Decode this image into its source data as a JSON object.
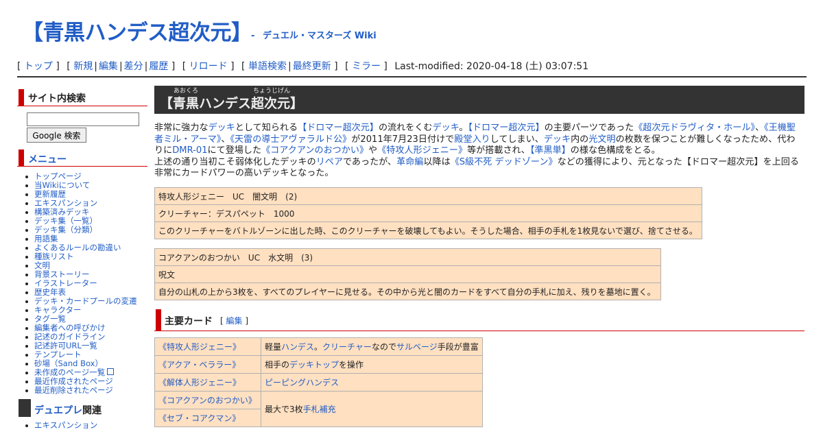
{
  "header": {
    "title": "【青黒ハンデス超次元】",
    "subtitle_dash": "-",
    "subtitle": "デュエル・マスターズ Wiki"
  },
  "nav": {
    "top": "トップ",
    "new": "新規",
    "edit": "編集",
    "diff": "差分",
    "history": "履歴",
    "reload": "リロード",
    "word_search": "単語検索",
    "recent": "最終更新",
    "mirror": "ミラー",
    "last_modified": "Last-modified: 2020-04-18 (土) 03:07:51"
  },
  "sidebar": {
    "search_heading": "サイト内検索",
    "search_value": "",
    "search_button": "Google 検索",
    "menu_heading": "メニュー",
    "menu_items": [
      "トップページ",
      "当Wikiについて",
      "更新履歴",
      "エキスパンション",
      "構築済みデッキ",
      "デッキ集（一覧）",
      "デッキ集（分類）",
      "用語集",
      "よくあるルールの勘違い",
      "種族リスト",
      "文明",
      "背景ストーリー",
      "イラストレーター",
      "歴史年表",
      "デッキ・カードプールの変遷",
      "キャラクター",
      "タグ一覧",
      "編集者への呼びかけ",
      "記述のガイドライン",
      "記述許可URL一覧",
      "テンプレート",
      "砂場（Sand Box）",
      "未作成のページ一覧",
      "最近作成されたページ",
      "最近削除されたページ"
    ],
    "dp_heading_link": "デュエプレ",
    "dp_heading_rest": "関連",
    "dp_items": [
      "エキスパンション"
    ]
  },
  "article": {
    "title": "【青黒ハンデス超次元】",
    "ruby_1": "あおくろ",
    "ruby_2": "ちょうじげん",
    "intro": [
      {
        "t": "非常に強力な"
      },
      {
        "t": "デッキ",
        "l": 1
      },
      {
        "t": "として知られる"
      },
      {
        "t": "【ドロマー超次元】",
        "l": 1
      },
      {
        "t": "の流れをくむ"
      },
      {
        "t": "デッキ",
        "l": 1
      },
      {
        "t": "。"
      },
      {
        "t": "【ドロマー超次元】",
        "l": 1
      },
      {
        "t": "の主要パーツであった"
      },
      {
        "t": "《超次元ドラヴィタ・ホール》",
        "l": 1
      },
      {
        "t": "、"
      },
      {
        "t": "《王機聖者ミル・アーマ》",
        "l": 1
      },
      {
        "t": "、"
      },
      {
        "t": "《天雷の導士アヴァラルド公》",
        "l": 1
      },
      {
        "t": "が2011年7月23日付けで"
      },
      {
        "t": "殿堂入り",
        "l": 1
      },
      {
        "t": "してしまい、"
      },
      {
        "t": "デッキ",
        "l": 1
      },
      {
        "t": "内の"
      },
      {
        "t": "光文明",
        "l": 1
      },
      {
        "t": "の枚数を保つことが難しくなったため、代わりに"
      },
      {
        "t": "DMR-01",
        "l": 1
      },
      {
        "t": "にて登場した"
      },
      {
        "t": "《コアクアンのおつかい》",
        "l": 1
      },
      {
        "t": "や"
      },
      {
        "t": "《特攻人形ジェニー》",
        "l": 1
      },
      {
        "t": "等が搭載され、"
      },
      {
        "t": "【準黒単】",
        "l": 1
      },
      {
        "t": "の様な色構成をとる。"
      },
      {
        "br": 1
      },
      {
        "t": "上述の通り当初こそ弱体化したデッキの"
      },
      {
        "t": "リペア",
        "l": 1
      },
      {
        "t": "であったが、"
      },
      {
        "t": "革命編",
        "l": 1
      },
      {
        "t": "以降は"
      },
      {
        "t": "《S級不死 デッドゾーン》",
        "l": 1
      },
      {
        "t": "などの獲得により、元となった【ドロマー超次元】を上回る非常にカードパワーの高いデッキとなった。"
      }
    ],
    "card1": {
      "line1": "特攻人形ジェニー　UC　闇文明　(2)",
      "line2": "クリーチャー：デスパペット　1000",
      "line3": "このクリーチャーをバトルゾーンに出した時、このクリーチャーを破壊してもよい。そうした場合、相手の手札を1枚見ないで選び、捨てさせる。"
    },
    "card2": {
      "line1": "コアクアンのおつかい　UC　水文明　(3)",
      "line2": "呪文",
      "line3": "自分の山札の上から3枚を、すべてのプレイヤーに見せる。その中から光と闇のカードをすべて自分の手札に加え、残りを墓地に置く。"
    },
    "section_heading": "主要カード",
    "section_edit_open": "[",
    "section_edit": "編集",
    "section_edit_close": "]",
    "main_cards": [
      {
        "name": "《特攻人形ジェニー》",
        "desc": [
          {
            "t": "軽量"
          },
          {
            "t": "ハンデス",
            "l": 1
          },
          {
            "t": "。"
          },
          {
            "t": "クリーチャー",
            "l": 1
          },
          {
            "t": "なので"
          },
          {
            "t": "サルベージ",
            "l": 1
          },
          {
            "t": "手段が豊富"
          }
        ]
      },
      {
        "name": "《アクア・ベララー》",
        "desc": [
          {
            "t": "相手の"
          },
          {
            "t": "デッキトップ",
            "l": 1
          },
          {
            "t": "を操作"
          }
        ]
      },
      {
        "name": "《解体人形ジェニー》",
        "desc": [
          {
            "t": "ピーピングハンデス",
            "l": 1
          }
        ]
      },
      {
        "name": "《コアクアンのおつかい》",
        "desc": [
          {
            "t": "最大で3枚"
          },
          {
            "t": "手札補充",
            "l": 1
          }
        ]
      },
      {
        "name": "《セブ・コアクマン》"
      }
    ]
  }
}
